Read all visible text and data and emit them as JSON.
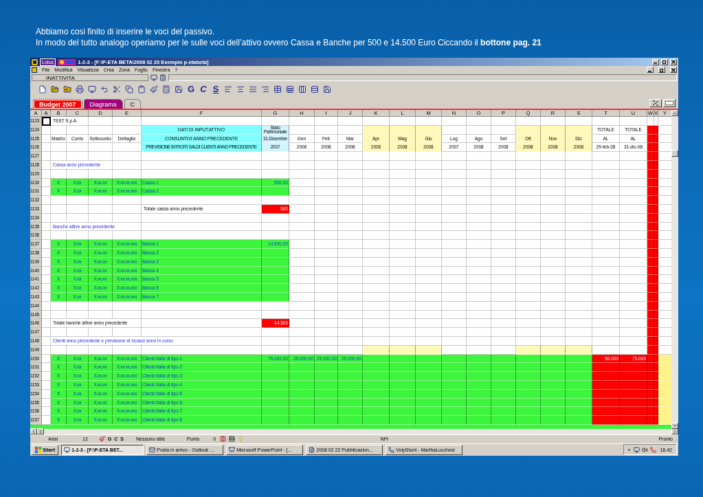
{
  "slide": {
    "caption_lines": [
      "Abbiamo cosi finito di inserire le voci del passivo.",
      "In modo del tutto analogo operiamo per le sulle voci dell’attivo ovvero Cassa e Banche per 500 e 14.500 Euro Ciccando il **bottone pag. 21**"
    ]
  },
  "window": {
    "logo": "Lotus",
    "title": "1-2-3 - [F:\\P-ETA BETA\\2008 02 20  Esempio p-etabeta]"
  },
  "menu": [
    "File",
    "Modifica",
    "Visualizza",
    "Crea",
    "Zona",
    "Foglio",
    "Finestra",
    "?"
  ],
  "edit_line": {
    "cell_name": "INATTIVITA"
  },
  "toolbar": {
    "style_buttons": [
      {
        "label": "G",
        "kind": "bold"
      },
      {
        "label": "C",
        "kind": "italic"
      },
      {
        "label": "S",
        "kind": "underline"
      }
    ]
  },
  "sheet_tabs": [
    {
      "label": "Budget 2007",
      "selected": true,
      "color": "#ff0000"
    },
    {
      "label": "Diagrama",
      "selected": false,
      "color": "#a0007a"
    },
    {
      "label": "C",
      "selected": false
    }
  ],
  "sheet": {
    "columns": [
      "A",
      "A",
      "B",
      "C",
      "D",
      "E",
      "F",
      "G",
      "H",
      "I",
      "J",
      "K",
      "L",
      "M",
      "N",
      "O",
      "P",
      "Q",
      "R",
      "S",
      "T",
      "U",
      "W",
      "X",
      "Y"
    ],
    "rows": [
      {
        "num": "1123",
        "kind": "title",
        "cursor": true,
        "cells": {
          "B": "TEST S.p.A."
        }
      },
      {
        "num": "1124",
        "kind": "header",
        "cells": {
          "F": "DATI DI INPUT:ATTIVO",
          "G": "Stato Patrimoniale",
          "T": "TOTALE",
          "U": "TOTALE"
        }
      },
      {
        "num": "1125",
        "kind": "header",
        "cells": {
          "B": "Mastro",
          "C": "Conto",
          "D": "Sottoconto",
          "E": "Dettaglio",
          "F": "CONSUNTIVI ANNO PRECEDENTE",
          "G": "31-Dicembre",
          "H": "Gen",
          "I": "Feb",
          "J": "Mar",
          "K": "Apr",
          "L": "Mag",
          "M": "Giu",
          "N": "Lug",
          "O": "Ago",
          "P": "Set",
          "Q": "Ott",
          "R": "Nov",
          "S": "Dic",
          "T": "AL",
          "U": "AL"
        }
      },
      {
        "num": "1126",
        "kind": "header",
        "cells": {
          "F": "PREVISIONE INTROITI SALDI CLIENTI ANNO PRECEDENTE",
          "G": "2007",
          "H": "2008",
          "I": "2008",
          "J": "2008",
          "K": "2008",
          "L": "2008",
          "M": "2008",
          "N": "2007",
          "O": "2008",
          "P": "2008",
          "Q": "2008",
          "R": "2008",
          "S": "2008",
          "T": "29-feb-08",
          "U": "31-dic-08"
        }
      },
      {
        "num": "1127",
        "kind": "blank"
      },
      {
        "num": "1128",
        "kind": "section",
        "cells": {
          "B": "Cassa anno precedente"
        }
      },
      {
        "num": "1129",
        "kind": "blank"
      },
      {
        "num": "1130",
        "kind": "item",
        "cells": {
          "B": "X",
          "C": "X.xx",
          "D": "X.xx.xx",
          "E": "X.xx.xx.xxx",
          "F": "Cassa 1",
          "G": "500,00"
        }
      },
      {
        "num": "1131",
        "kind": "item",
        "cells": {
          "B": "X",
          "C": "X.xx",
          "D": "X.xx.xx",
          "E": "X.xx.xx.xxx",
          "F": "Cassa 2"
        }
      },
      {
        "num": "1132",
        "kind": "blank"
      },
      {
        "num": "1133",
        "kind": "total",
        "cells": {
          "F": "Totale cassa anno precedente",
          "G": "500"
        }
      },
      {
        "num": "1134",
        "kind": "blank"
      },
      {
        "num": "1135",
        "kind": "section",
        "cells": {
          "B": "Banche attive anno precedente"
        }
      },
      {
        "num": "1136",
        "kind": "blank"
      },
      {
        "num": "1137",
        "kind": "item",
        "cells": {
          "B": "X",
          "C": "X.xx",
          "D": "X.xx.xx",
          "E": "X.xx.xx.xxx",
          "F": "Banca 1",
          "G": "14.500,00"
        }
      },
      {
        "num": "1138",
        "kind": "item",
        "cells": {
          "B": "X",
          "C": "X.xx",
          "D": "X.xx.xx",
          "E": "X.xx.xx.xxx",
          "F": "Banca 2"
        }
      },
      {
        "num": "1139",
        "kind": "item",
        "cells": {
          "B": "X",
          "C": "X.xx",
          "D": "X.xx.xx",
          "E": "X.xx.xx.xxx",
          "F": "Banca 3"
        }
      },
      {
        "num": "1140",
        "kind": "item",
        "cells": {
          "B": "X",
          "C": "X.xx",
          "D": "X.xx.xx",
          "E": "X.xx.xx.xxx",
          "F": "Banca 4"
        }
      },
      {
        "num": "1141",
        "kind": "item",
        "cells": {
          "B": "X",
          "C": "X.xx",
          "D": "X.xx.xx",
          "E": "X.xx.xx.xxx",
          "F": "Banca 5"
        }
      },
      {
        "num": "1142",
        "kind": "item",
        "cells": {
          "B": "X",
          "C": "X.xx",
          "D": "X.xx.xx",
          "E": "X.xx.xx.xxx",
          "F": "Banca 6"
        }
      },
      {
        "num": "1143",
        "kind": "item",
        "cells": {
          "B": "X",
          "C": "X.xx",
          "D": "X.xx.xx",
          "E": "X.xx.xx.xxx",
          "F": "Banca 7"
        }
      },
      {
        "num": "1144",
        "kind": "blank"
      },
      {
        "num": "1145",
        "kind": "blank"
      },
      {
        "num": "1146",
        "kind": "total",
        "cells": {
          "B": "Totale  banche attive anno precedente",
          "G": "14.500"
        }
      },
      {
        "num": "1147",
        "kind": "blank"
      },
      {
        "num": "1148",
        "kind": "section",
        "cells": {
          "B": "Clienti anno precedente e previsione di incassi anno in corso"
        }
      },
      {
        "num": "1149",
        "kind": "band"
      },
      {
        "num": "1150",
        "kind": "client",
        "cells": {
          "B": "X",
          "C": "X.xx",
          "D": "X.xx.xx",
          "E": "X.xx.xx.xxx",
          "F": "Clienti Italia di tipo 1",
          "G": "75.000,00",
          "H": "25.000,00",
          "I": "25.000,00",
          "J": "25.000,00",
          "T": "50.000",
          "U": "75.000"
        }
      },
      {
        "num": "1151",
        "kind": "client",
        "cells": {
          "B": "X",
          "C": "X.xx",
          "D": "X.xx.xx",
          "E": "X.xx.xx.xxx",
          "F": "Clienti Italia di tipo 2"
        }
      },
      {
        "num": "1152",
        "kind": "client",
        "cells": {
          "B": "X",
          "C": "X.xx",
          "D": "X.xx.xx",
          "E": "X.xx.xx.xxx",
          "F": "Clienti Italia di tipo 3"
        }
      },
      {
        "num": "1153",
        "kind": "client",
        "cells": {
          "B": "X",
          "C": "X.xx",
          "D": "X.xx.xx",
          "E": "X.xx.xx.xxx",
          "F": "Clienti Italia di tipo 4"
        }
      },
      {
        "num": "1154",
        "kind": "client",
        "cells": {
          "B": "X",
          "C": "X.xx",
          "D": "X.xx.xx",
          "E": "X.xx.xx.xxx",
          "F": "Clienti Italia di tipo 5"
        }
      },
      {
        "num": "1155",
        "kind": "client",
        "cells": {
          "B": "X",
          "C": "X.xx",
          "D": "X.xx.xx",
          "E": "X.xx.xx.xxx",
          "F": "Clienti Italia di tipo 6"
        }
      },
      {
        "num": "1156",
        "kind": "client",
        "cells": {
          "B": "X",
          "C": "X.xx",
          "D": "X.xx.xx",
          "E": "X.xx.xx.xxx",
          "F": "Clienti Italia di tipo 7"
        }
      },
      {
        "num": "1157",
        "kind": "client",
        "cells": {
          "B": "X",
          "C": "X.xx",
          "D": "X.xx.xx",
          "E": "X.xx.xx.xxx",
          "F": "Clienti Italia di tipo 8"
        }
      }
    ]
  },
  "status_bar": {
    "font": "Arial",
    "size": "12",
    "styles": [
      "G",
      "C",
      "S"
    ],
    "style": "Nessuno stile",
    "unit": "Punto",
    "decimals": "0",
    "mode": "NPr",
    "state": "Pronto"
  },
  "taskbar": {
    "start": "Start",
    "tasks": [
      {
        "label": "1-2-3 - [F:\\P-ETA BET...",
        "selected": true
      },
      {
        "label": "Posta in arrivo - Outlook ...",
        "selected": false
      },
      {
        "label": "Microsoft PowerPoint - [...",
        "selected": false
      },
      {
        "label": "2008 02 22 Pubblicazion...",
        "selected": false
      },
      {
        "label": "VoipStunt - MarthaLucchesi",
        "selected": false
      }
    ],
    "chevron": "«",
    "clock": "18.42"
  }
}
